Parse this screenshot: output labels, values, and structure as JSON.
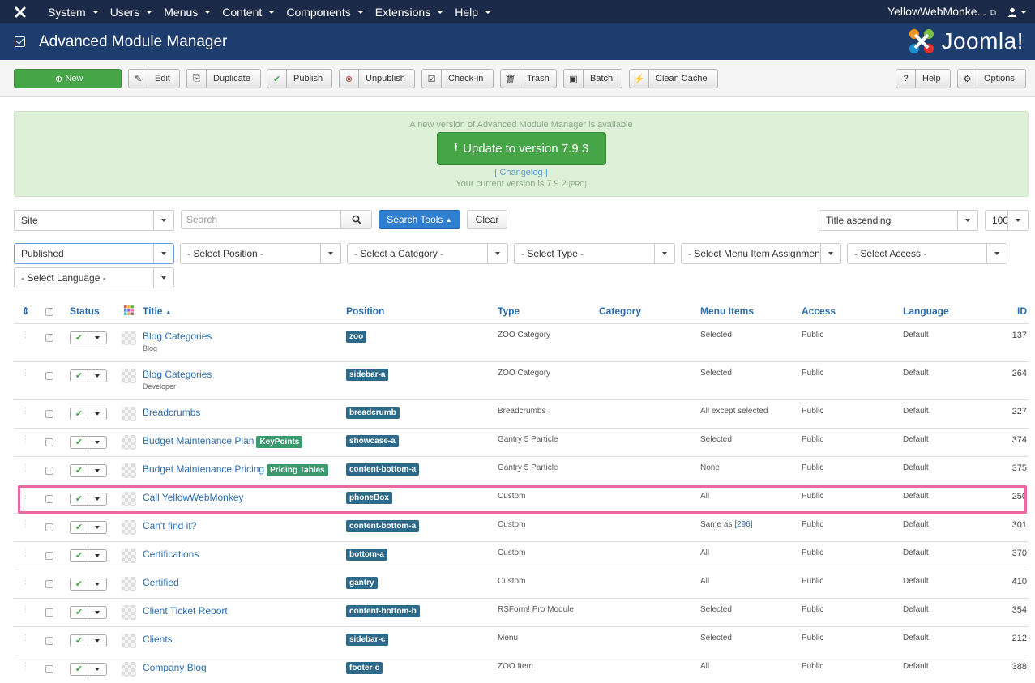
{
  "topnav": {
    "items": [
      "System",
      "Users",
      "Menus",
      "Content",
      "Components",
      "Extensions",
      "Help"
    ],
    "site_name": "YellowWebMonke...",
    "logo_icon": "joomla-icon",
    "user_icon": "user-icon"
  },
  "header": {
    "title": "Advanced Module Manager",
    "brand": "Joomla!"
  },
  "toolbar": {
    "new": "New",
    "edit": "Edit",
    "duplicate": "Duplicate",
    "publish": "Publish",
    "unpublish": "Unpublish",
    "checkin": "Check-in",
    "trash": "Trash",
    "batch": "Batch",
    "clean_cache": "Clean Cache",
    "help": "Help",
    "options": "Options"
  },
  "notice": {
    "message": "A new version of Advanced Module Manager is available",
    "update_button": "Update to version 7.9.3",
    "changelog": "[ Changelog ]",
    "current_version": "Your current version is 7.9.2",
    "edition": "[PRO]"
  },
  "filters": {
    "client": "Site",
    "search_placeholder": "Search",
    "search_tools": "Search Tools",
    "clear": "Clear",
    "ordering": "Title ascending",
    "limit": "100",
    "state": "Published",
    "position": "- Select Position -",
    "category": "- Select a Category -",
    "type": "- Select Type -",
    "menu_assignment": "- Select Menu Item Assignment",
    "access": "- Select Access -",
    "language": "- Select Language -"
  },
  "table": {
    "headers": {
      "status": "Status",
      "title": "Title",
      "position": "Position",
      "type": "Type",
      "category": "Category",
      "menu_items": "Menu Items",
      "access": "Access",
      "language": "Language",
      "id": "ID"
    },
    "rows": [
      {
        "title": "Blog Categories",
        "sub": "Blog",
        "tag": "",
        "position": "zoo",
        "type": "ZOO Category",
        "menu": "Selected",
        "menu_link": "",
        "access": "Public",
        "language": "Default",
        "id": "137"
      },
      {
        "title": "Blog Categories",
        "sub": "Developer",
        "tag": "",
        "position": "sidebar-a",
        "type": "ZOO Category",
        "menu": "Selected",
        "menu_link": "",
        "access": "Public",
        "language": "Default",
        "id": "264"
      },
      {
        "title": "Breadcrumbs",
        "sub": "",
        "tag": "",
        "position": "breadcrumb",
        "type": "Breadcrumbs",
        "menu": "All except selected",
        "menu_link": "",
        "access": "Public",
        "language": "Default",
        "id": "227"
      },
      {
        "title": "Budget Maintenance Plan",
        "sub": "",
        "tag": "KeyPoints",
        "position": "showcase-a",
        "type": "Gantry 5 Particle",
        "menu": "Selected",
        "menu_link": "",
        "access": "Public",
        "language": "Default",
        "id": "374"
      },
      {
        "title": "Budget Maintenance Pricing",
        "sub": "",
        "tag": "Pricing Tables",
        "position": "content-bottom-a",
        "type": "Gantry 5 Particle",
        "menu": "None",
        "menu_link": "",
        "access": "Public",
        "language": "Default",
        "id": "375"
      },
      {
        "title": "Call YellowWebMonkey",
        "sub": "",
        "tag": "",
        "position": "phoneBox",
        "type": "Custom",
        "menu": "All",
        "menu_link": "",
        "access": "Public",
        "language": "Default",
        "id": "250"
      },
      {
        "title": "Can't find it?",
        "sub": "",
        "tag": "",
        "position": "content-bottom-a",
        "type": "Custom",
        "menu": "Same as",
        "menu_link": "[296]",
        "access": "Public",
        "language": "Default",
        "id": "301"
      },
      {
        "title": "Certifications",
        "sub": "",
        "tag": "",
        "position": "bottom-a",
        "type": "Custom",
        "menu": "All",
        "menu_link": "",
        "access": "Public",
        "language": "Default",
        "id": "370"
      },
      {
        "title": "Certified",
        "sub": "",
        "tag": "",
        "position": "gantry",
        "type": "Custom",
        "menu": "All",
        "menu_link": "",
        "access": "Public",
        "language": "Default",
        "id": "410"
      },
      {
        "title": "Client Ticket Report",
        "sub": "",
        "tag": "",
        "position": "content-bottom-b",
        "type": "RSForm! Pro Module",
        "menu": "Selected",
        "menu_link": "",
        "access": "Public",
        "language": "Default",
        "id": "354"
      },
      {
        "title": "Clients",
        "sub": "",
        "tag": "",
        "position": "sidebar-c",
        "type": "Menu",
        "menu": "Selected",
        "menu_link": "",
        "access": "Public",
        "language": "Default",
        "id": "212"
      },
      {
        "title": "Company Blog",
        "sub": "",
        "tag": "",
        "position": "footer-c",
        "type": "ZOO Item",
        "menu": "All",
        "menu_link": "",
        "access": "Public",
        "language": "Default",
        "id": "388"
      }
    ]
  },
  "colors": {
    "topbar": "#1a2a48",
    "header": "#1c3d6e",
    "success": "#46a546",
    "link": "#2a6cad",
    "highlight": "#e86aa0"
  }
}
